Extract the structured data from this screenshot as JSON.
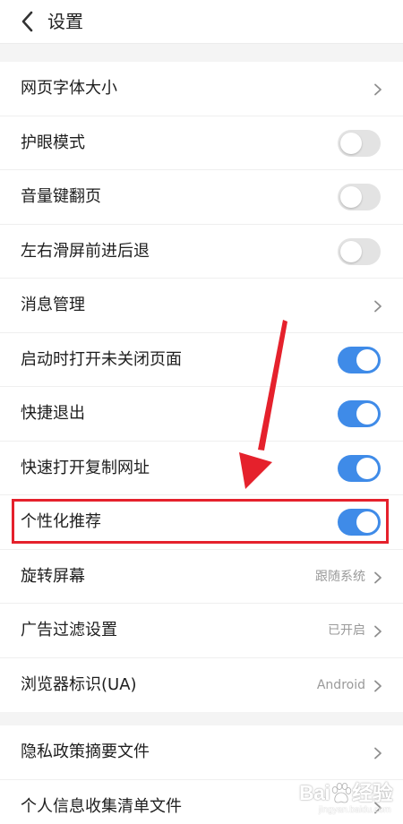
{
  "colors": {
    "accent": "#3f8be8",
    "toggle_off": "#e3e3e3",
    "highlight": "#e5212c"
  },
  "header": {
    "back_icon": "chevron-left-icon",
    "title": "设置"
  },
  "settings": [
    {
      "label": "网页字体大小",
      "type": "link"
    },
    {
      "label": "护眼模式",
      "type": "toggle",
      "on": false
    },
    {
      "label": "音量键翻页",
      "type": "toggle",
      "on": false
    },
    {
      "label": "左右滑屏前进后退",
      "type": "toggle",
      "on": false
    },
    {
      "label": "消息管理",
      "type": "link"
    },
    {
      "label": "启动时打开未关闭页面",
      "type": "toggle",
      "on": true
    },
    {
      "label": "快捷退出",
      "type": "toggle",
      "on": true
    },
    {
      "label": "快速打开复制网址",
      "type": "toggle",
      "on": true
    },
    {
      "label": "个性化推荐",
      "type": "toggle",
      "on": true
    },
    {
      "label": "旋转屏幕",
      "type": "link",
      "value": "跟随系统"
    },
    {
      "label": "广告过滤设置",
      "type": "link",
      "value": "已开启"
    },
    {
      "label": "浏览器标识(UA)",
      "type": "link",
      "value": "Android"
    }
  ],
  "documents": [
    {
      "label": "隐私政策摘要文件",
      "type": "link"
    },
    {
      "label": "个人信息收集清单文件",
      "type": "link"
    }
  ],
  "watermark": {
    "brand_left": "Bai",
    "brand_right": "经验",
    "sub": "jingyan.baidu.com"
  }
}
